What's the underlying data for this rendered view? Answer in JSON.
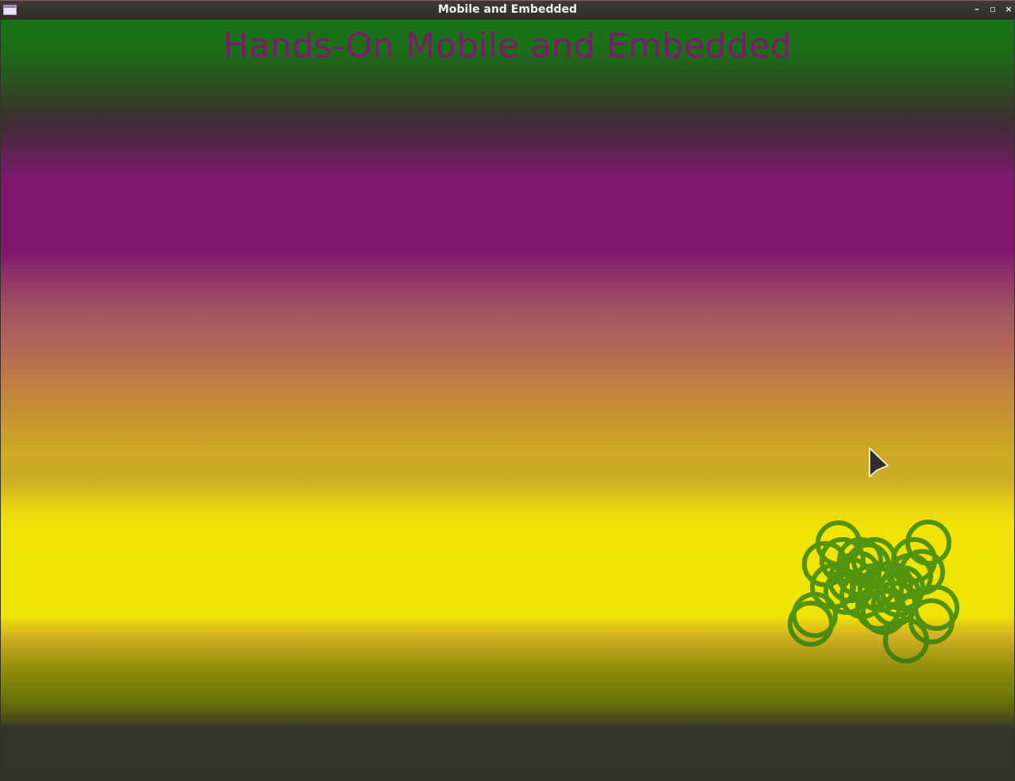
{
  "window": {
    "title": "Mobile and Embedded",
    "buttons": {
      "minimize": "–",
      "maximize": "▫",
      "close": "×"
    }
  },
  "app": {
    "heading": "Hands-On Mobile and Embedded"
  },
  "colors": {
    "heading": "#7e1a6e",
    "ring": "#1f7a10",
    "band_green": "#1a7316",
    "band_purple": "#7e176e",
    "band_yellow": "#f0e308"
  },
  "icons": {
    "app": "window-icon",
    "cursor": "arrow-cursor"
  }
}
